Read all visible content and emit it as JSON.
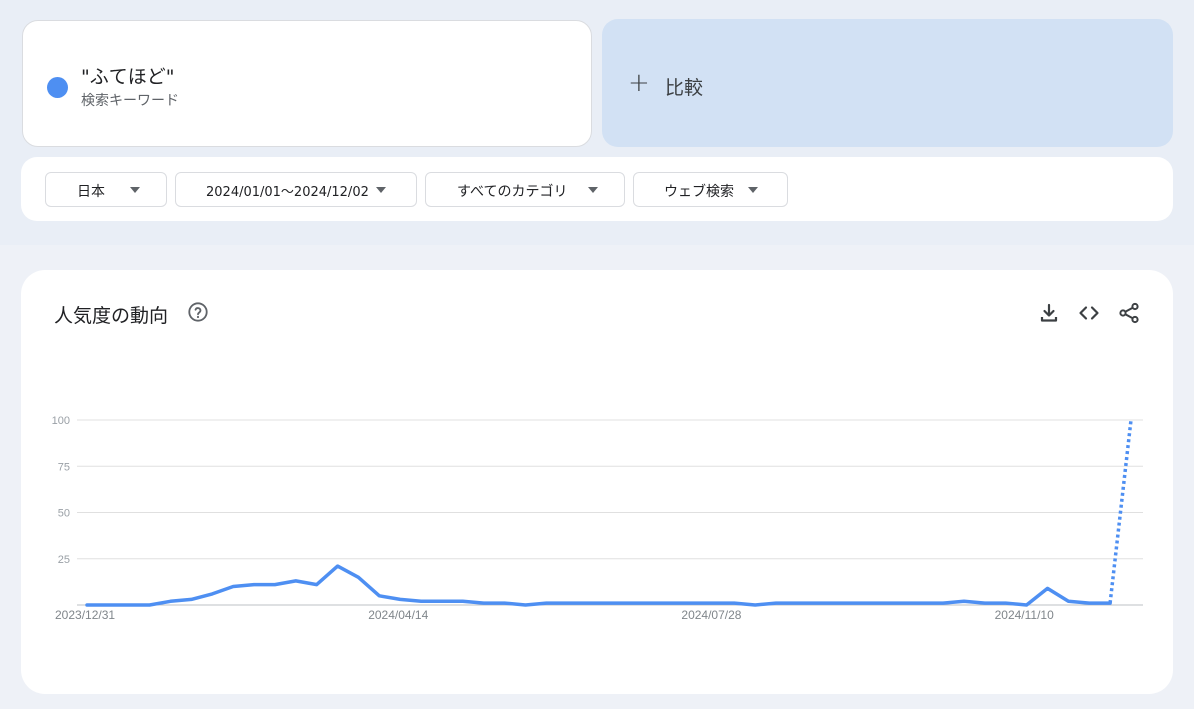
{
  "search_term": {
    "name": "\"ふてほど\"",
    "type": "検索キーワード",
    "color": "#4e8ff2"
  },
  "compare": {
    "icon": "plus-icon",
    "label": "比較"
  },
  "filters": {
    "region": "日本",
    "date_range": "2024/01/01～2024/12/02",
    "category": "すべてのカテゴリ",
    "search_type": "ウェブ検索"
  },
  "panel": {
    "title": "人気度の動向",
    "icons": [
      "help-icon",
      "download-icon",
      "embed-code-icon",
      "share-icon"
    ]
  },
  "chart_data": {
    "type": "line",
    "title": "",
    "xlabel": "",
    "ylabel": "",
    "ylim": [
      0,
      100
    ],
    "yticks": [
      "0",
      "25",
      "50",
      "75",
      "100"
    ],
    "xtick_labels": [
      "2023/12/31",
      "2024/04/14",
      "2024/07/28",
      "2024/11/10"
    ],
    "xtick_indices": [
      0,
      15,
      30,
      45
    ],
    "grid": true,
    "series": [
      {
        "color": "#4e8ff2",
        "values": [
          0,
          0,
          0,
          0,
          2,
          3,
          6,
          10,
          11,
          11,
          13,
          11,
          21,
          15,
          5,
          3,
          2,
          2,
          2,
          1,
          1,
          0,
          1,
          1,
          1,
          1,
          1,
          1,
          1,
          1,
          1,
          1,
          0,
          1,
          1,
          1,
          1,
          1,
          1,
          1,
          1,
          1,
          2,
          1,
          1,
          0,
          9,
          2,
          1,
          1,
          100
        ],
        "partial_from_index": 49
      }
    ]
  }
}
